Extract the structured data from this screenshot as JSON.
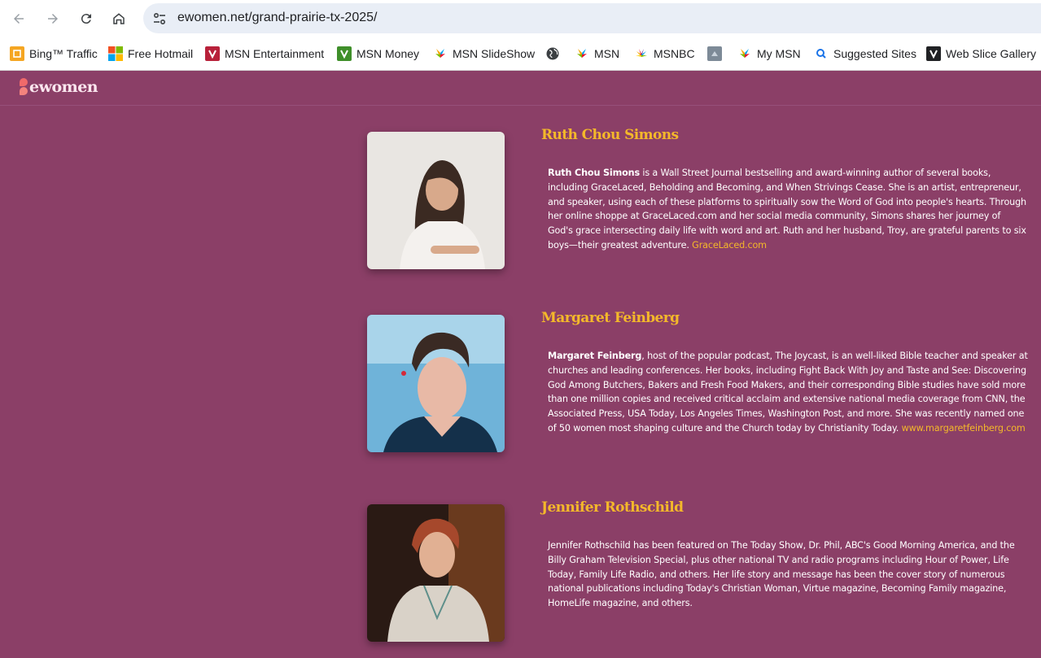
{
  "browser": {
    "url": "ewomen.net/grand-prairie-tx-2025/",
    "bookmarks": [
      {
        "label": "Bing™ Traffic",
        "icon": "bing-icon"
      },
      {
        "label": "Free Hotmail",
        "icon": "windows-icon"
      },
      {
        "label": "MSN Entertainment",
        "icon": "msn-entertainment-icon"
      },
      {
        "label": "MSN Money",
        "icon": "msn-money-icon"
      },
      {
        "label": "MSN SlideShow",
        "icon": "msn-butterfly-icon"
      },
      {
        "label": "",
        "icon": "globe-icon"
      },
      {
        "label": "MSN",
        "icon": "msn-butterfly-icon"
      },
      {
        "label": "MSNBC",
        "icon": "nbc-peacock-icon"
      },
      {
        "label": "",
        "icon": "web-slice-icon"
      },
      {
        "label": "My MSN",
        "icon": "msn-butterfly-icon"
      },
      {
        "label": "Suggested Sites",
        "icon": "search-icon"
      },
      {
        "label": "Web Slice Gallery",
        "icon": "web-slice-gallery-icon"
      }
    ]
  },
  "site": {
    "logo_text": "ewomen"
  },
  "speakers": [
    {
      "name": "Ruth Chou Simons",
      "bio_bold": "Ruth Chou Simons",
      "bio_text": " is a Wall Street Journal bestselling and award-winning author of several books, including GraceLaced, Beholding and Becoming, and When Strivings Cease. She is an artist, entrepreneur, and speaker, using each of these platforms to spiritually sow the Word of God into people's hearts. Through her online shoppe at GraceLaced.com and her social media community, Simons shares her journey of God's grace intersecting daily life with word and art. Ruth and her husband, Troy, are grateful parents to six boys—their greatest adventure. ",
      "bio_link": "GraceLaced.com"
    },
    {
      "name": "Margaret Feinberg",
      "bio_bold": "Margaret Feinberg",
      "bio_text": ", host of the popular podcast, The Joycast, is an well-liked Bible teacher and speaker at churches and leading conferences. Her books, including Fight Back With Joy and Taste and See: Discovering God Among Butchers, Bakers and Fresh Food Makers, and their corresponding Bible studies have sold more than one million copies and received critical acclaim and extensive national media coverage from CNN, the Associated Press, USA Today, Los Angeles Times, Washington Post, and more. She was recently named one of 50 women most shaping culture and the Church today by Christianity Today. ",
      "bio_link": "www.margaretfeinberg.com"
    },
    {
      "name": "Jennifer Rothschild",
      "bio_bold": "",
      "bio_text": "Jennifer Rothschild has been featured on The Today Show, Dr. Phil, ABC's Good Morning America, and the Billy Graham Television Special, plus other national TV and radio programs including Hour of Power, Life Today, Family Life Radio, and others. Her life story and message has been the cover story of numerous national publications including Today's Christian Woman, Virtue magazine, Becoming Family magazine, HomeLife magazine, and others.",
      "bio_link": ""
    }
  ],
  "colors": {
    "background": "#8b3f67",
    "accent": "#f4b82a",
    "text": "#ffffff"
  }
}
